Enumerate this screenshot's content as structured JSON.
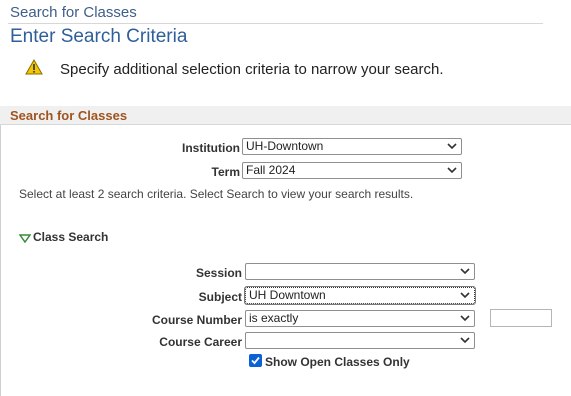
{
  "header": {
    "title": "Search for Classes",
    "heading": "Enter Search Criteria"
  },
  "warning": {
    "icon": "warning-icon",
    "message": "Specify additional selection criteria to narrow your search."
  },
  "section": {
    "title": "Search for Classes",
    "institution": {
      "label": "Institution",
      "value": "UH-Downtown"
    },
    "term": {
      "label": "Term",
      "value": "Fall 2024"
    },
    "instructions": "Select at least 2 search criteria. Select Search to view your search results.",
    "class_search": {
      "label": "Class Search",
      "session": {
        "label": "Session",
        "value": ""
      },
      "subject": {
        "label": "Subject",
        "value": "UH Downtown"
      },
      "course_number": {
        "label": "Course Number",
        "operator": "is exactly",
        "value": ""
      },
      "course_career": {
        "label": "Course Career",
        "value": ""
      },
      "open_only": {
        "label": "Show Open Classes Only",
        "checked": true
      }
    }
  },
  "colors": {
    "heading_blue": "#2f5f9a",
    "section_title": "#a0541e",
    "checkbox_blue": "#0b62d6",
    "warning_yellow": "#f2c600"
  }
}
